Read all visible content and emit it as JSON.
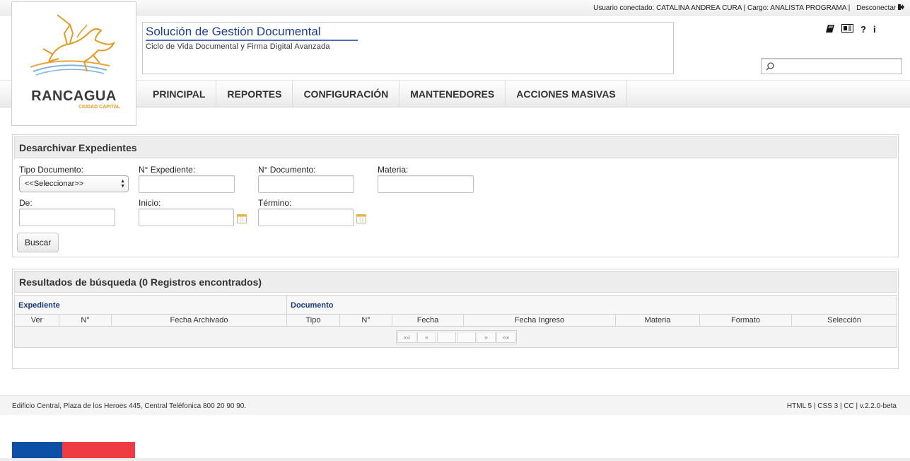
{
  "header": {
    "user_prefix": "Usuario conectado:",
    "user_name": "CATALINA ANDREA CURA",
    "role_prefix": "Cargo:",
    "role": "ANALISTA PROGRAMA",
    "logout_label": "Desconectar"
  },
  "logo": {
    "name": "RANCAGUA",
    "subtitle": "CIUDAD CAPITAL"
  },
  "app": {
    "title": "Solución de Gestión Documental",
    "subtitle": "Ciclo de Vida Documental y Firma Digital Avanzada"
  },
  "toolbar_icons": [
    "book-icon",
    "newspaper-icon",
    "help-icon",
    "info-icon"
  ],
  "toolbar": {
    "help_glyph": "?",
    "info_glyph": "i"
  },
  "search": {
    "placeholder": ""
  },
  "nav": {
    "items": [
      "PRINCIPAL",
      "REPORTES",
      "CONFIGURACIÓN",
      "MANTENEDORES",
      "ACCIONES MASIVAS"
    ]
  },
  "filter_panel": {
    "title": "Desarchivar Expedientes",
    "tipo_documento_label": "Tipo Documento:",
    "tipo_documento_value": "<<Seleccionar>>",
    "expediente_label": "N° Expediente:",
    "documento_label": "N° Documento:",
    "materia_label": "Materia:",
    "de_label": "De:",
    "inicio_label": "Inicio:",
    "termino_label": "Término:",
    "search_button": "Buscar"
  },
  "results_panel": {
    "title": "Resultados de búsqueda (0 Registros encontrados)",
    "group_expediente": "Expediente",
    "group_documento": "Documento",
    "columns": [
      "Ver",
      "N°",
      "Fecha Archivado",
      "Tipo",
      "N°",
      "Fecha",
      "Fecha Ingreso",
      "Materia",
      "Formato",
      "Selección"
    ],
    "pager": {
      "first": "««",
      "prev": "«",
      "next": "»",
      "last": "»»"
    }
  },
  "footer": {
    "address": "Edificio Central, Plaza de los Heroes 445, Central Teléfonica 800 20 90 90.",
    "tech": "HTML 5 | CSS 3 | CC | v.2.2.0-beta"
  },
  "colors": {
    "brand_blue": "#1c3f8f",
    "flag_blue": "#0b4fa6",
    "flag_red": "#ee3c42",
    "logo_orange": "#e39a24"
  }
}
